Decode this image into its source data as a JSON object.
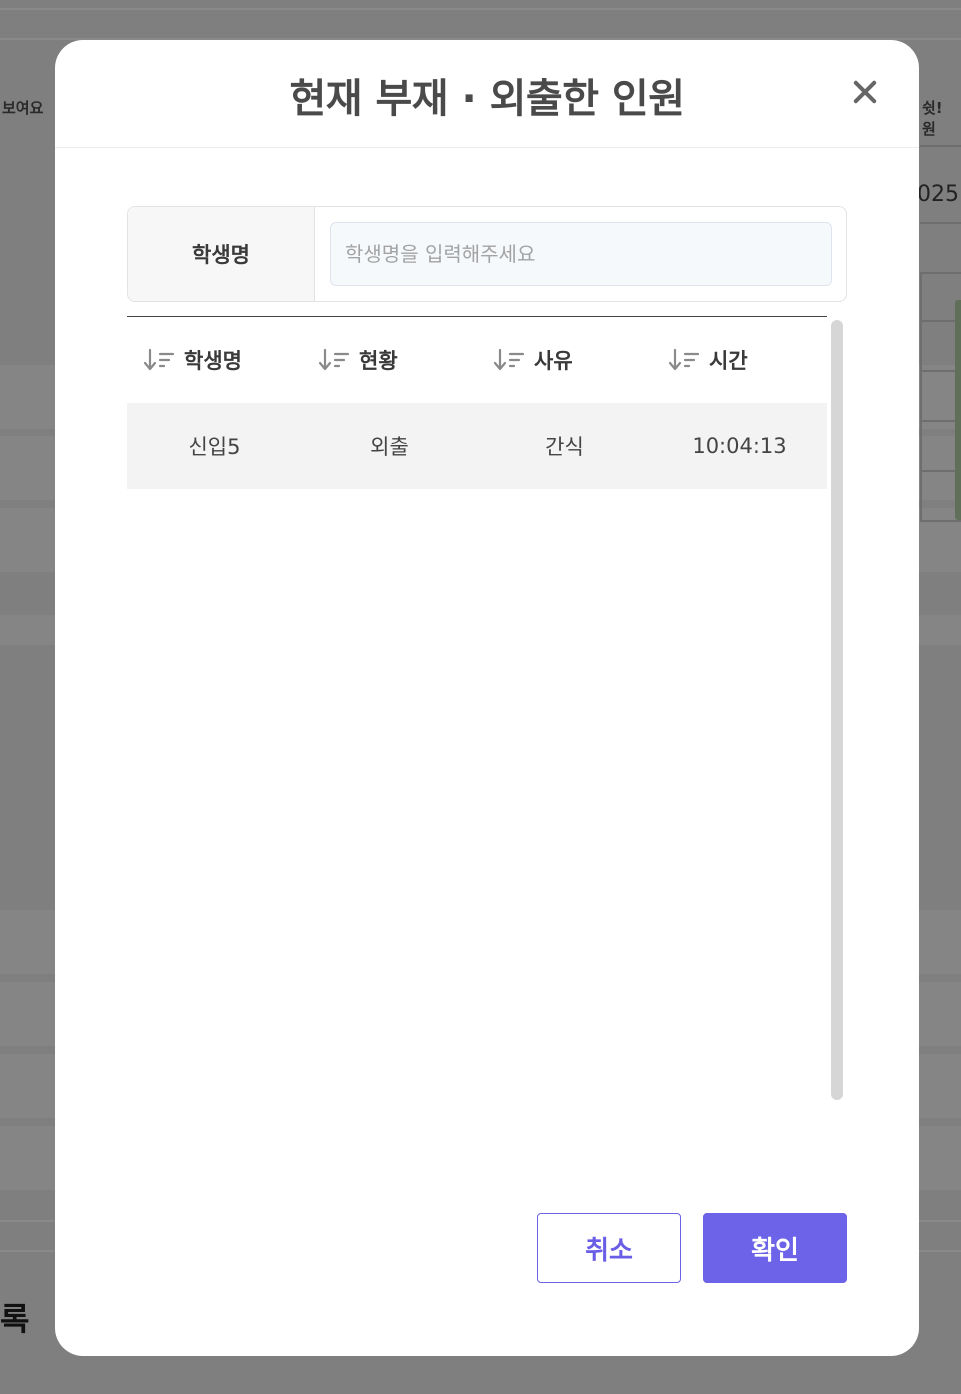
{
  "background": {
    "left_text": "보여요",
    "right_text": "쉿! 원",
    "year_fragment": "025",
    "bottom_heading": "록"
  },
  "modal": {
    "title": "현재 부재 · 외출한 인원",
    "search": {
      "label": "학생명",
      "placeholder": "학생명을 입력해주세요",
      "value": ""
    },
    "table": {
      "columns": [
        "학생명",
        "현황",
        "사유",
        "시간"
      ],
      "rows": [
        [
          "신입5",
          "외출",
          "간식",
          "10:04:13"
        ]
      ]
    },
    "buttons": {
      "cancel": "취소",
      "confirm": "확인"
    }
  },
  "colors": {
    "accent": "#6c63e8",
    "overlay": "#808080"
  }
}
